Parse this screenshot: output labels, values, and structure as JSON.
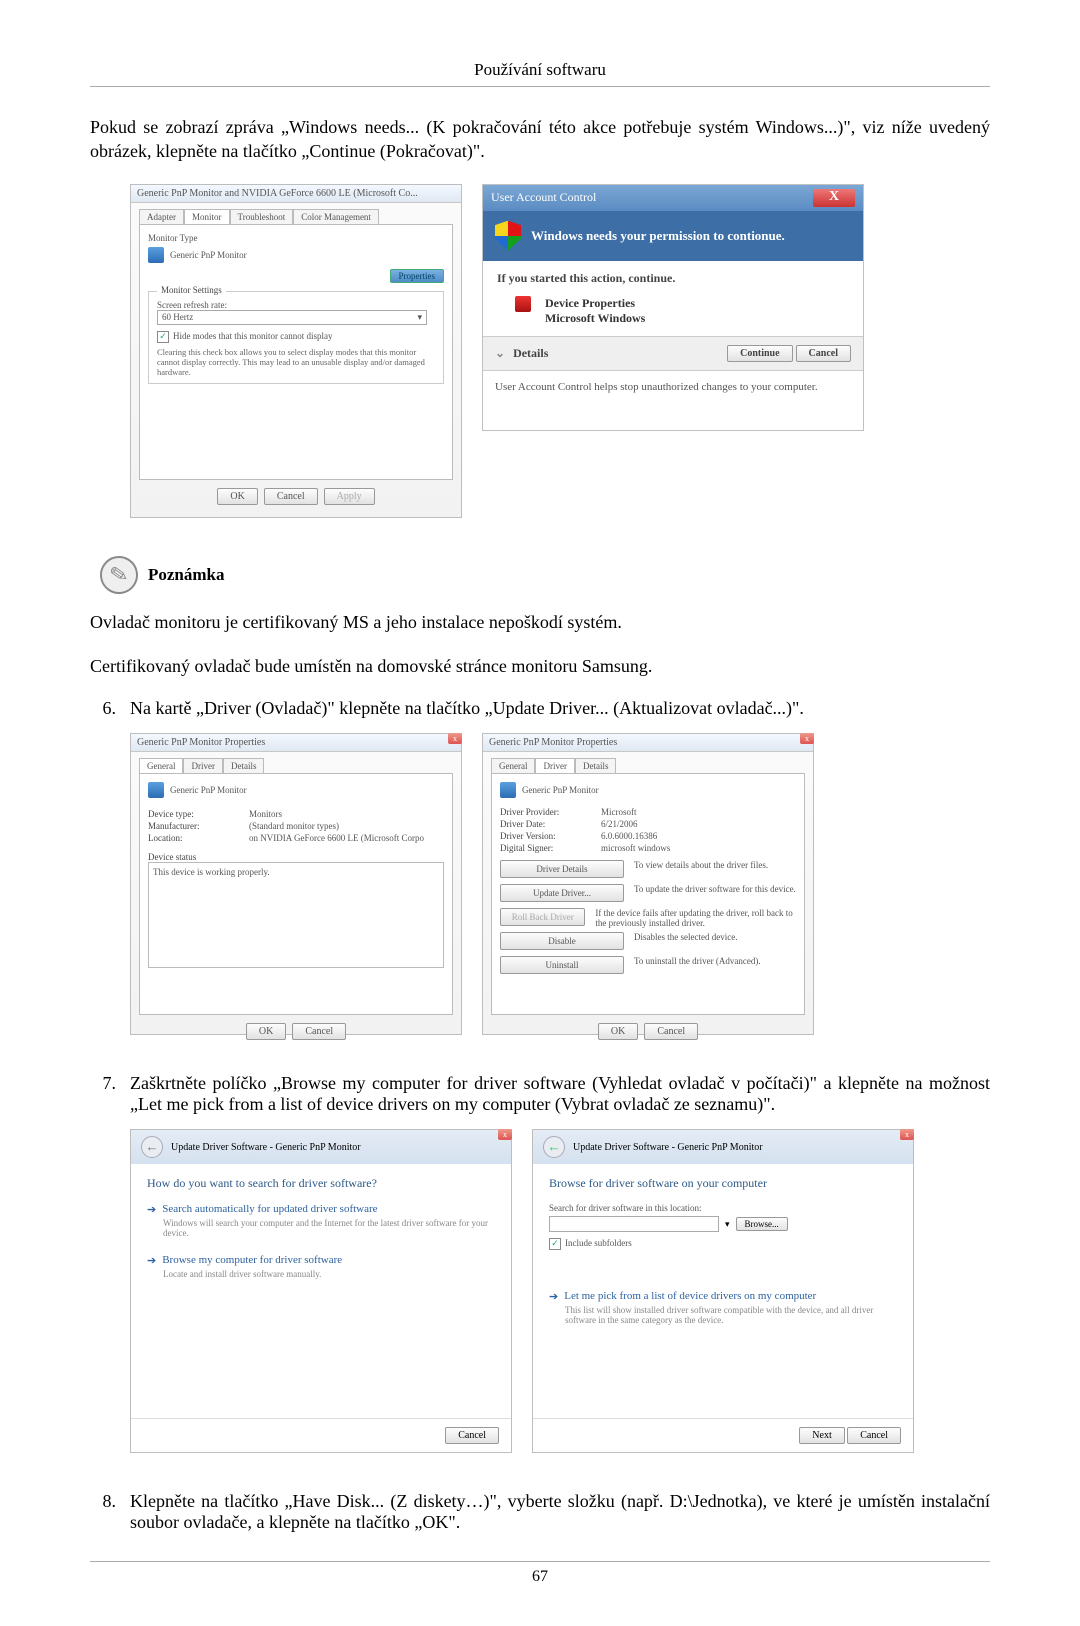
{
  "header": "Používání softwaru",
  "pageNumber": "67",
  "intro": "Pokud se zobrazí zpráva „Windows needs... (K pokračování této akce potřebuje systém Windows...)\", viz níže uvedený obrázek, klepněte na tlačítko „Continue (Pokračovat)\".",
  "monitorPropsDialog": {
    "title": "Generic PnP Monitor and NVIDIA GeForce 6600 LE (Microsoft Co...",
    "tabs": {
      "adapter": "Adapter",
      "monitor": "Monitor",
      "troubleshoot": "Troubleshoot",
      "color": "Color Management"
    },
    "monitorTypeLabel": "Monitor Type",
    "monitorTypeValue": "Generic PnP Monitor",
    "propertiesBtn": "Properties",
    "settingsGroup": "Monitor Settings",
    "refreshLabel": "Screen refresh rate:",
    "refreshValue": "60 Hertz",
    "hideCheck": "Hide modes that this monitor cannot display",
    "hideNote": "Clearing this check box allows you to select display modes that this monitor cannot display correctly. This may lead to an unusable display and/or damaged hardware.",
    "okBtn": "OK",
    "cancelBtn": "Cancel",
    "applyBtn": "Apply"
  },
  "uac": {
    "title": "User Account Control",
    "close": "X",
    "banner": "Windows needs your permission to contionue.",
    "ifStarted": "If you started this action, continue.",
    "line1": "Device Properties",
    "line2": "Microsoft Windows",
    "details": "Details",
    "continueBtn": "Continue",
    "cancelBtn": "Cancel",
    "footnote": "User Account Control helps stop unauthorized changes to your computer."
  },
  "note": {
    "label": "Poznámka",
    "line1": "Ovladač monitoru je certifikovaný MS a jeho instalace nepoškodí systém.",
    "line2": "Certifikovaný ovladač bude umístěn na domovské stránce monitoru Samsung."
  },
  "items": {
    "n6": "6.",
    "t6": "Na kartě „Driver (Ovladač)\" klepněte na tlačítko „Update Driver... (Aktualizovat ovladač...)\".",
    "n7": "7.",
    "t7": "Zaškrtněte políčko „Browse my computer for driver software (Vyhledat ovladač v počítači)\" a klepněte na možnost „Let me pick from a list of device drivers on my computer (Vybrat ovladač ze seznamu)\".",
    "n8": "8.",
    "t8": "Klepněte na tlačítko „Have Disk... (Z diskety…)\", vyberte složku (např. D:\\Jednotka), ve které je umístěn instalační soubor ovladače, a klepněte na tlačítko „OK\"."
  },
  "devPropsGeneral": {
    "title": "Generic PnP Monitor Properties",
    "tabs": {
      "general": "General",
      "driver": "Driver",
      "details": "Details"
    },
    "name": "Generic PnP Monitor",
    "deviceType": {
      "k": "Device type:",
      "v": "Monitors"
    },
    "manufacturer": {
      "k": "Manufacturer:",
      "v": "(Standard monitor types)"
    },
    "location": {
      "k": "Location:",
      "v": "on NVIDIA GeForce 6600 LE (Microsoft Corpo"
    },
    "statusLabel": "Device status",
    "status": "This device is working properly.",
    "ok": "OK",
    "cancel": "Cancel"
  },
  "devPropsDriver": {
    "title": "Generic PnP Monitor Properties",
    "name": "Generic PnP Monitor",
    "provider": {
      "k": "Driver Provider:",
      "v": "Microsoft"
    },
    "date": {
      "k": "Driver Date:",
      "v": "6/21/2006"
    },
    "version": {
      "k": "Driver Version:",
      "v": "6.0.6000.16386"
    },
    "signer": {
      "k": "Digital Signer:",
      "v": "microsoft windows"
    },
    "btnDetails": "Driver Details",
    "descDetails": "To view details about the driver files.",
    "btnUpdate": "Update Driver...",
    "descUpdate": "To update the driver software for this device.",
    "btnRollback": "Roll Back Driver",
    "descRollback": "If the device fails after updating the driver, roll back to the previously installed driver.",
    "btnDisable": "Disable",
    "descDisable": "Disables the selected device.",
    "btnUninstall": "Uninstall",
    "descUninstall": "To uninstall the driver (Advanced).",
    "ok": "OK",
    "cancel": "Cancel"
  },
  "wizardSearch": {
    "title": "Update Driver Software - Generic PnP Monitor",
    "question": "How do you want to search for driver software?",
    "opt1": "Search automatically for updated driver software",
    "opt1desc": "Windows will search your computer and the Internet for the latest driver software for your device.",
    "opt2": "Browse my computer for driver software",
    "opt2desc": "Locate and install driver software manually.",
    "cancel": "Cancel"
  },
  "wizardBrowse": {
    "title": "Update Driver Software - Generic PnP Monitor",
    "heading": "Browse for driver software on your computer",
    "searchLabel": "Search for driver software in this location:",
    "browseBtn": "Browse...",
    "include": "Include subfolders",
    "letme": "Let me pick from a list of device drivers on my computer",
    "letmeDesc": "This list will show installed driver software compatible with the device, and all driver software in the same category as the device.",
    "next": "Next",
    "cancel": "Cancel"
  }
}
